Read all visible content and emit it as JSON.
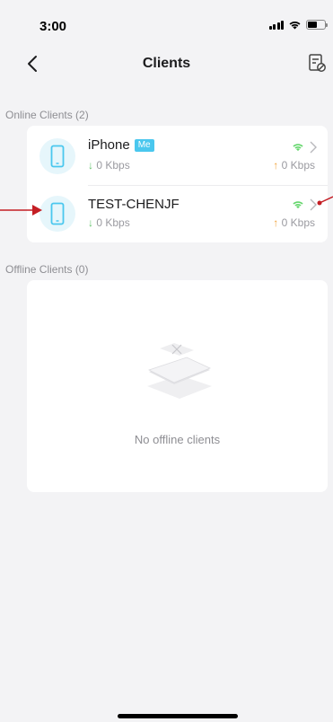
{
  "status_bar": {
    "time": "3:00"
  },
  "nav": {
    "title": "Clients"
  },
  "online": {
    "section_label": "Online Clients (2)",
    "clients": [
      {
        "name": "iPhone",
        "badge": "Me",
        "down": "0 Kbps",
        "up": "0 Kbps",
        "device": "phone-icon"
      },
      {
        "name": "TEST-CHENJF",
        "badge": "",
        "down": "0 Kbps",
        "up": "0 Kbps",
        "device": "phone-icon"
      }
    ]
  },
  "offline": {
    "section_label": "Offline Clients (0)",
    "empty_text": "No offline clients"
  },
  "colors": {
    "accent": "#4ac7ee",
    "wifi": "#63d66b",
    "upload_arrow": "#f0a23a",
    "download_arrow": "#63c26a",
    "annotation": "#c41e24"
  }
}
